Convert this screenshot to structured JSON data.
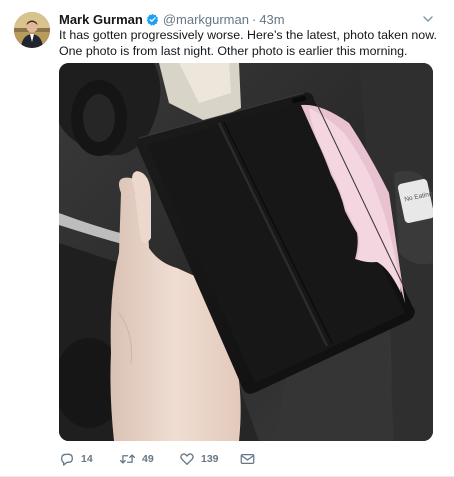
{
  "tweet": {
    "author_name": "Mark Gurman",
    "handle": "@markgurman",
    "separator": "·",
    "time": "43m",
    "text": "It has gotten progressively worse. Here’s the latest, photo taken now. One photo is from last night. Other photo is earlier this morning.",
    "media": {
      "car_sign_text": "No Eating Please"
    },
    "actions": {
      "reply_count": "14",
      "retweet_count": "49",
      "like_count": "139"
    },
    "icons": {
      "verified": "verified-badge-icon",
      "caret": "chevron-down-icon",
      "reply": "reply-icon",
      "retweet": "retweet-icon",
      "like": "heart-icon",
      "dm": "envelope-icon"
    },
    "colors": {
      "name": "#14171a",
      "secondary": "#657786",
      "verified": "#1da1f2",
      "divider": "#e6ecf0"
    }
  }
}
